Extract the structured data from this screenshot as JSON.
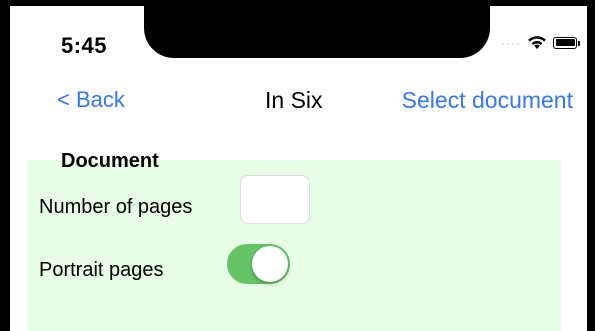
{
  "status_bar": {
    "time": "5:45",
    "signal_icon": "signal-dots",
    "wifi_icon": "wifi",
    "battery_icon": "battery-full"
  },
  "nav": {
    "back_label": "< Back",
    "title": "In Six",
    "action_label": "Select document"
  },
  "document_section": {
    "title": "Document",
    "number_of_pages_label": "Number of pages",
    "number_of_pages_value": "",
    "portrait_pages_label": "Portrait pages",
    "portrait_pages_on": true
  },
  "colors": {
    "link": "#3478f6",
    "panel_background": "#e8fde6",
    "toggle_on": "#65c466"
  }
}
